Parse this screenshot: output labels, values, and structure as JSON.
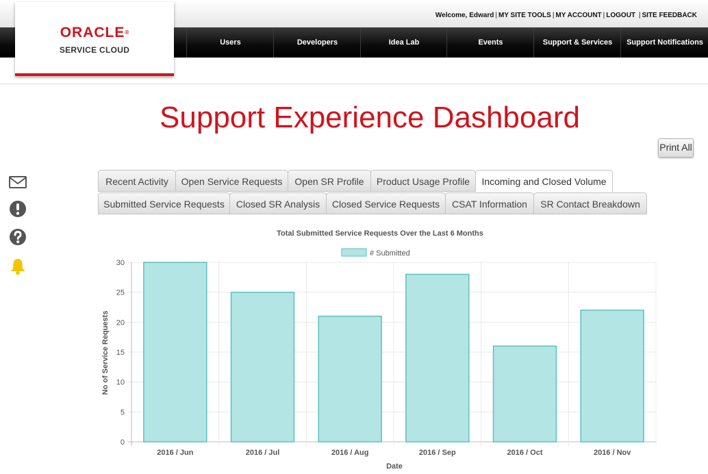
{
  "header": {
    "welcome": "Welcome, Edward",
    "links": [
      "MY SITE TOOLS",
      "MY ACCOUNT",
      "LOGOUT",
      "SITE FEEDBACK"
    ]
  },
  "logo": {
    "brand": "ORACLE",
    "reg_mark": "®",
    "product": "SERVICE CLOUD"
  },
  "nav": {
    "items": [
      "Users",
      "Developers",
      "Idea Lab",
      "Events",
      "Support & Services",
      "Support Notifications"
    ]
  },
  "page": {
    "title": "Support Experience Dashboard",
    "print_label": "Print All"
  },
  "sidebar": {
    "icons": [
      "envelope-icon",
      "alert-icon",
      "help-icon",
      "bell-icon"
    ]
  },
  "tabs": {
    "row1": [
      "Recent Activity",
      "Open Service Requests",
      "Open SR Profile",
      "Product Usage Profile",
      "Incoming and Closed Volume"
    ],
    "row2": [
      "Submitted Service Requests",
      "Closed SR Analysis",
      "Closed Service Requests",
      "CSAT Information",
      "SR Contact Breakdown"
    ],
    "active": "Incoming and Closed Volume"
  },
  "colors": {
    "brand_red": "#d0141e",
    "bar_fill": "#b3e5e5",
    "bar_stroke": "#5bc0be",
    "bell": "#f5c400"
  },
  "chart_data": {
    "type": "bar",
    "title": "Total Submitted Service Requests Over the Last 6 Months",
    "categories": [
      "2016 / Jun",
      "2016 / Jul",
      "2016 / Aug",
      "2016 / Sep",
      "2016 / Oct",
      "2016 / Nov"
    ],
    "series": [
      {
        "name": "# Submitted",
        "values": [
          30,
          25,
          21,
          28,
          16,
          22
        ]
      }
    ],
    "xlabel": "Date",
    "ylabel": "No of Service Requests",
    "ylim": [
      0,
      30
    ],
    "yticks": [
      0,
      5,
      10,
      15,
      20,
      25,
      30
    ],
    "grid": true,
    "legend": "top"
  }
}
